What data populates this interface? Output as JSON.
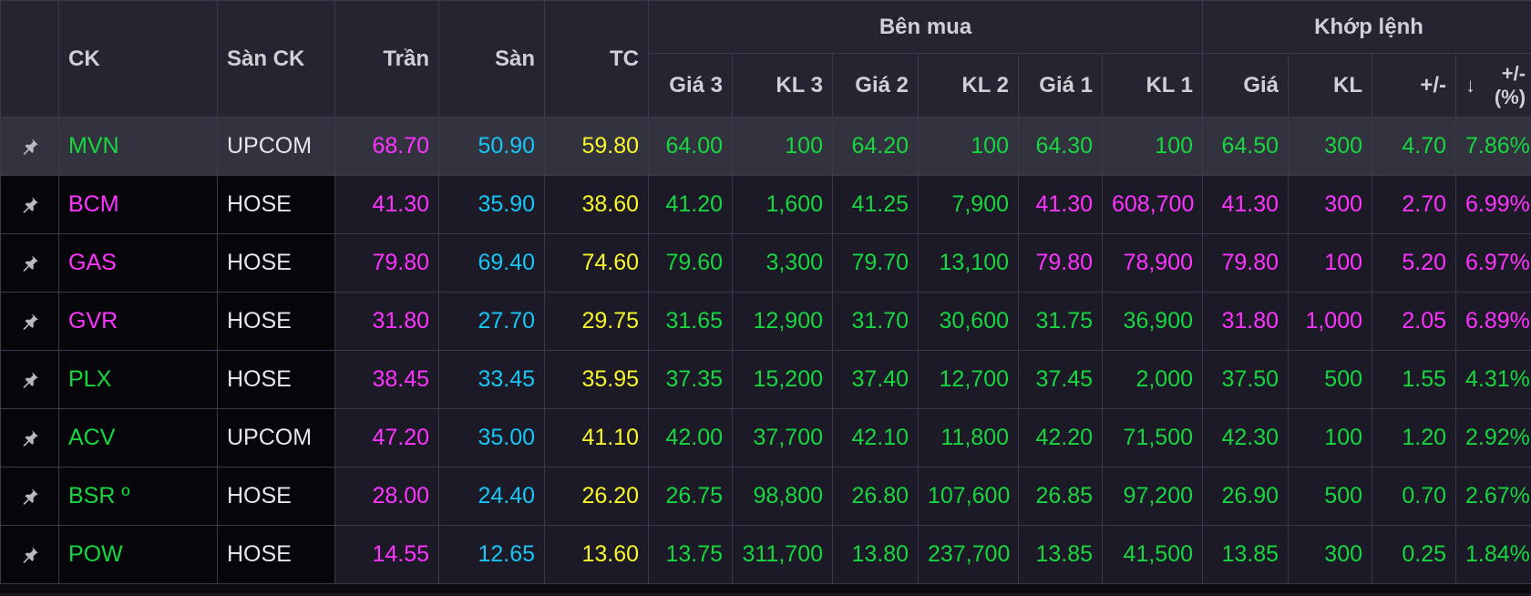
{
  "colors": {
    "ceiling": "#ff33ff",
    "floor": "#18c5f5",
    "reference": "#f7f72c",
    "up": "#17d640",
    "text": "#e6e6ea"
  },
  "icons": {
    "pin": "pin-icon",
    "sort": "arrow-down-icon"
  },
  "headers": {
    "ck": "CK",
    "san_ck": "Sàn CK",
    "tran": "Trần",
    "san": "Sàn",
    "tc": "TC",
    "ben_mua": "Bên mua",
    "gia3": "Giá 3",
    "kl3": "KL 3",
    "gia2": "Giá 2",
    "kl2": "KL 2",
    "gia1": "Giá 1",
    "kl1": "KL 1",
    "khop_lenh": "Khớp lệnh",
    "gia": "Giá",
    "kl": "KL",
    "change": "+/-",
    "sort_arrow": "↓",
    "change_pct_1": "+/-",
    "change_pct_2": "(%)"
  },
  "rows": [
    {
      "ck": "MVN",
      "ck_color": "up",
      "san": "UPCOM",
      "tran": "68.70",
      "san_price": "50.90",
      "tc": "59.80",
      "gia3": "64.00",
      "gia3_color": "up",
      "kl3": "100",
      "kl3_color": "up",
      "gia2": "64.20",
      "gia2_color": "up",
      "kl2": "100",
      "kl2_color": "up",
      "gia1": "64.30",
      "gia1_color": "up",
      "kl1": "100",
      "kl1_color": "up",
      "gia": "64.50",
      "gia_color": "up",
      "kl": "300",
      "kl_color": "up",
      "chg": "4.70",
      "chg_color": "up",
      "pct": "7.86%",
      "pct_color": "up"
    },
    {
      "ck": "BCM",
      "ck_color": "ceiling",
      "san": "HOSE",
      "tran": "41.30",
      "san_price": "35.90",
      "tc": "38.60",
      "gia3": "41.20",
      "gia3_color": "up",
      "kl3": "1,600",
      "kl3_color": "up",
      "gia2": "41.25",
      "gia2_color": "up",
      "kl2": "7,900",
      "kl2_color": "up",
      "gia1": "41.30",
      "gia1_color": "ceiling",
      "kl1": "608,700",
      "kl1_color": "ceiling",
      "gia": "41.30",
      "gia_color": "ceiling",
      "kl": "300",
      "kl_color": "ceiling",
      "chg": "2.70",
      "chg_color": "ceiling",
      "pct": "6.99%",
      "pct_color": "ceiling"
    },
    {
      "ck": "GAS",
      "ck_color": "ceiling",
      "san": "HOSE",
      "tran": "79.80",
      "san_price": "69.40",
      "tc": "74.60",
      "gia3": "79.60",
      "gia3_color": "up",
      "kl3": "3,300",
      "kl3_color": "up",
      "gia2": "79.70",
      "gia2_color": "up",
      "kl2": "13,100",
      "kl2_color": "up",
      "gia1": "79.80",
      "gia1_color": "ceiling",
      "kl1": "78,900",
      "kl1_color": "ceiling",
      "gia": "79.80",
      "gia_color": "ceiling",
      "kl": "100",
      "kl_color": "ceiling",
      "chg": "5.20",
      "chg_color": "ceiling",
      "pct": "6.97%",
      "pct_color": "ceiling"
    },
    {
      "ck": "GVR",
      "ck_color": "ceiling",
      "san": "HOSE",
      "tran": "31.80",
      "san_price": "27.70",
      "tc": "29.75",
      "gia3": "31.65",
      "gia3_color": "up",
      "kl3": "12,900",
      "kl3_color": "up",
      "gia2": "31.70",
      "gia2_color": "up",
      "kl2": "30,600",
      "kl2_color": "up",
      "gia1": "31.75",
      "gia1_color": "up",
      "kl1": "36,900",
      "kl1_color": "up",
      "gia": "31.80",
      "gia_color": "ceiling",
      "kl": "1,000",
      "kl_color": "ceiling",
      "chg": "2.05",
      "chg_color": "ceiling",
      "pct": "6.89%",
      "pct_color": "ceiling"
    },
    {
      "ck": "PLX",
      "ck_color": "up",
      "san": "HOSE",
      "tran": "38.45",
      "san_price": "33.45",
      "tc": "35.95",
      "gia3": "37.35",
      "gia3_color": "up",
      "kl3": "15,200",
      "kl3_color": "up",
      "gia2": "37.40",
      "gia2_color": "up",
      "kl2": "12,700",
      "kl2_color": "up",
      "gia1": "37.45",
      "gia1_color": "up",
      "kl1": "2,000",
      "kl1_color": "up",
      "gia": "37.50",
      "gia_color": "up",
      "kl": "500",
      "kl_color": "up",
      "chg": "1.55",
      "chg_color": "up",
      "pct": "4.31%",
      "pct_color": "up"
    },
    {
      "ck": "ACV",
      "ck_color": "up",
      "san": "UPCOM",
      "tran": "47.20",
      "san_price": "35.00",
      "tc": "41.10",
      "gia3": "42.00",
      "gia3_color": "up",
      "kl3": "37,700",
      "kl3_color": "up",
      "gia2": "42.10",
      "gia2_color": "up",
      "kl2": "11,800",
      "kl2_color": "up",
      "gia1": "42.20",
      "gia1_color": "up",
      "kl1": "71,500",
      "kl1_color": "up",
      "gia": "42.30",
      "gia_color": "up",
      "kl": "100",
      "kl_color": "up",
      "chg": "1.20",
      "chg_color": "up",
      "pct": "2.92%",
      "pct_color": "up"
    },
    {
      "ck": "BSR º",
      "ck_color": "up",
      "san": "HOSE",
      "tran": "28.00",
      "san_price": "24.40",
      "tc": "26.20",
      "gia3": "26.75",
      "gia3_color": "up",
      "kl3": "98,800",
      "kl3_color": "up",
      "gia2": "26.80",
      "gia2_color": "up",
      "kl2": "107,600",
      "kl2_color": "up",
      "gia1": "26.85",
      "gia1_color": "up",
      "kl1": "97,200",
      "kl1_color": "up",
      "gia": "26.90",
      "gia_color": "up",
      "kl": "500",
      "kl_color": "up",
      "chg": "0.70",
      "chg_color": "up",
      "pct": "2.67%",
      "pct_color": "up"
    },
    {
      "ck": "POW",
      "ck_color": "up",
      "san": "HOSE",
      "tran": "14.55",
      "san_price": "12.65",
      "tc": "13.60",
      "gia3": "13.75",
      "gia3_color": "up",
      "kl3": "311,700",
      "kl3_color": "up",
      "gia2": "13.80",
      "gia2_color": "up",
      "kl2": "237,700",
      "kl2_color": "up",
      "gia1": "13.85",
      "gia1_color": "up",
      "kl1": "41,500",
      "kl1_color": "up",
      "gia": "13.85",
      "gia_color": "up",
      "kl": "300",
      "kl_color": "up",
      "chg": "0.25",
      "chg_color": "up",
      "pct": "1.84%",
      "pct_color": "up"
    }
  ]
}
